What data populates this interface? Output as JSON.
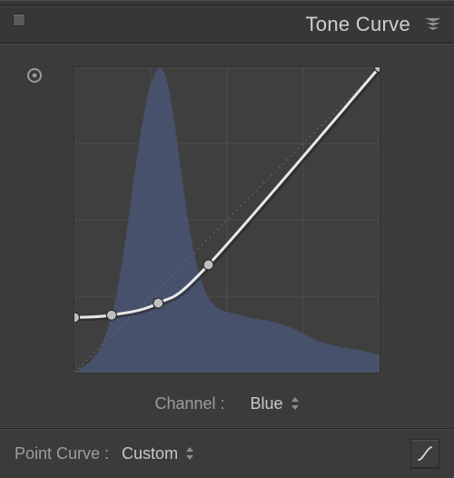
{
  "panel": {
    "title": "Tone Curve",
    "channel_label": "Channel :",
    "channel_value": "Blue",
    "point_curve_label": "Point Curve :",
    "point_curve_value": "Custom"
  },
  "chart_data": {
    "type": "line",
    "x_range": [
      0,
      255
    ],
    "y_range": [
      0,
      255
    ],
    "grid": {
      "x_divisions": 4,
      "y_divisions": 4
    },
    "curve_points": [
      {
        "x": 0,
        "y": 46
      },
      {
        "x": 31,
        "y": 48
      },
      {
        "x": 70,
        "y": 58
      },
      {
        "x": 112,
        "y": 90
      },
      {
        "x": 255,
        "y": 255
      }
    ],
    "baseline": {
      "start": {
        "x": 0,
        "y": 0
      },
      "end": {
        "x": 255,
        "y": 255
      }
    },
    "histogram": [
      0,
      1,
      2,
      4,
      5,
      7,
      8,
      10,
      13,
      15,
      18,
      22,
      27,
      32,
      38,
      45,
      53,
      62,
      72,
      84,
      96,
      110,
      124,
      139,
      154,
      168,
      182,
      196,
      208,
      219,
      229,
      237,
      244,
      249,
      253,
      255,
      254,
      251,
      245,
      237,
      226,
      213,
      199,
      184,
      169,
      154,
      140,
      127,
      115,
      104,
      94,
      86,
      79,
      73,
      68,
      64,
      61,
      58,
      56,
      54,
      53,
      52,
      51,
      51,
      50,
      50,
      49,
      49,
      48,
      48,
      47,
      47,
      46,
      46,
      45,
      45,
      45,
      44,
      44,
      44,
      43,
      43,
      42,
      42,
      41,
      41,
      40,
      39,
      39,
      38,
      37,
      36,
      35,
      34,
      33,
      32,
      31,
      30,
      29,
      28,
      27,
      26,
      26,
      25,
      24,
      24,
      23,
      23,
      22,
      22,
      21,
      21,
      21,
      20,
      20,
      20,
      19,
      19,
      19,
      18,
      18,
      17,
      17,
      16,
      16,
      15,
      15
    ],
    "histogram_max": 255
  }
}
